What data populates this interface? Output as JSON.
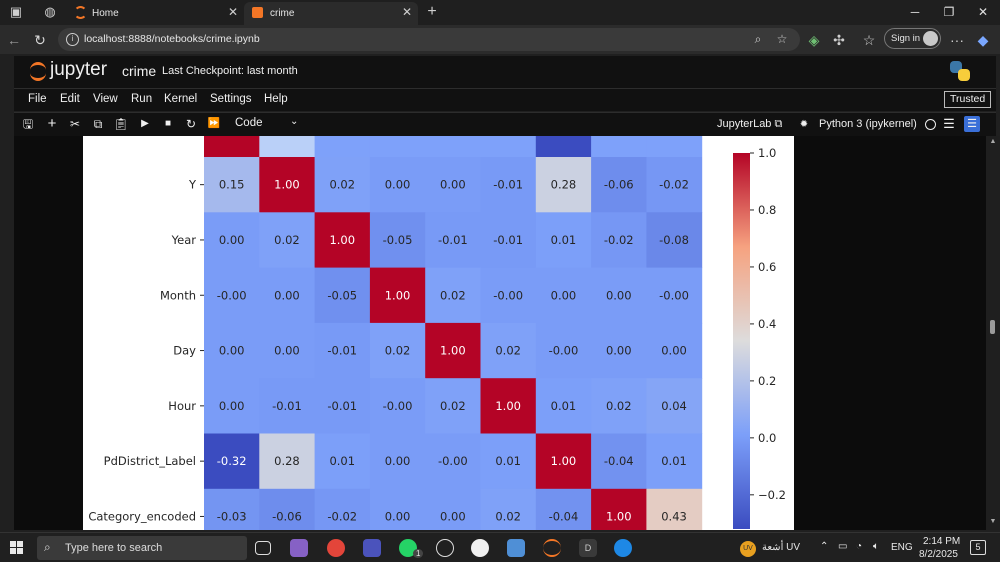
{
  "browser": {
    "tabs": [
      {
        "label": "Home",
        "active": false
      },
      {
        "label": "crime",
        "active": true
      }
    ],
    "url": "localhost:8888/notebooks/crime.ipynb",
    "signin_label": "Sign in"
  },
  "jupyter": {
    "wordmark": "jupyter",
    "notebook_name": "crime",
    "checkpoint": "Last Checkpoint: last month",
    "menu": [
      "File",
      "Edit",
      "View",
      "Run",
      "Kernel",
      "Settings",
      "Help"
    ],
    "trusted": "Trusted",
    "cell_type": "Code",
    "jupyterlab_link": "JupyterLab",
    "kernel_name": "Python 3 (ipykernel)"
  },
  "chart_data": {
    "type": "heatmap",
    "colormap": "coolwarm",
    "row_labels": [
      "Y",
      "Year",
      "Month",
      "Day",
      "Hour",
      "PdDistrict_Label",
      "Category_encoded"
    ],
    "partial_top_row_colors": [
      "#b40426",
      "#bad0f8",
      "#7ea1fa",
      "#7ea1fa",
      "#7ea1fa",
      "#7ea1fa",
      "#3b4cc0",
      "#7ea1fa",
      "#7ea1fa"
    ],
    "values": [
      [
        "0.15",
        "1.00",
        "0.02",
        "0.00",
        "0.00",
        "-0.01",
        "0.28",
        "-0.06",
        "-0.02"
      ],
      [
        "0.00",
        "0.02",
        "1.00",
        "-0.05",
        "-0.01",
        "-0.01",
        "0.01",
        "-0.02",
        "-0.08"
      ],
      [
        "-0.00",
        "0.00",
        "-0.05",
        "1.00",
        "0.02",
        "-0.00",
        "0.00",
        "0.00",
        "-0.00"
      ],
      [
        "0.00",
        "0.00",
        "-0.01",
        "0.02",
        "1.00",
        "0.02",
        "-0.00",
        "0.00",
        "0.00"
      ],
      [
        "0.00",
        "-0.01",
        "-0.01",
        "-0.00",
        "0.02",
        "1.00",
        "0.01",
        "0.02",
        "0.04"
      ],
      [
        "-0.32",
        "0.28",
        "0.01",
        "0.00",
        "-0.00",
        "0.01",
        "1.00",
        "-0.04",
        "0.01"
      ],
      [
        "-0.03",
        "-0.06",
        "-0.02",
        "0.00",
        "0.00",
        "0.02",
        "-0.04",
        "1.00",
        "0.43"
      ]
    ],
    "colorbar": {
      "vmin": -0.32,
      "vmax": 1.0,
      "ticks": [
        "1.0",
        "0.8",
        "0.6",
        "0.4",
        "0.2",
        "0.0",
        "−0.2"
      ]
    }
  },
  "taskbar": {
    "search_placeholder": "Type here to search",
    "weather": "أشعة UV",
    "language": "ENG",
    "time": "2:14 PM",
    "date": "8/2/2025",
    "notification_count": "5",
    "whatsapp_badge": "1"
  }
}
